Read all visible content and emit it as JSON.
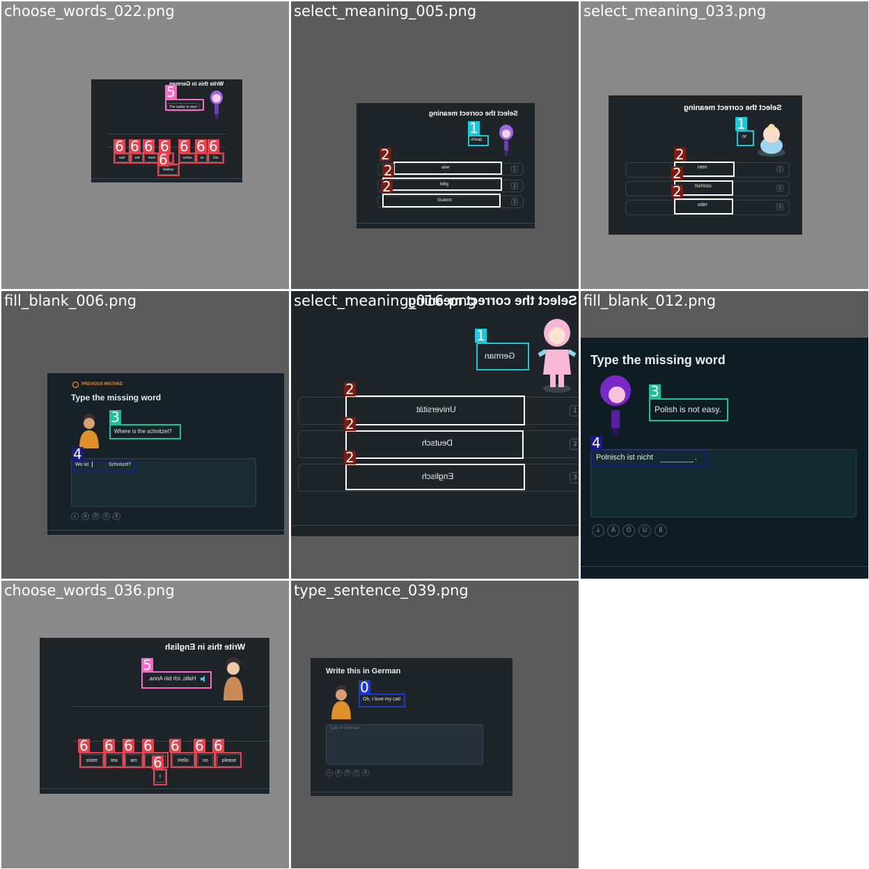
{
  "tiles": [
    {
      "name": "choose_words_022.png",
      "prompt_mirrored": "Write this in German",
      "bubble": "The waiter is nice!",
      "chips": [
        "nett",
        "Kellner",
        "mit",
        "mein",
        "ich",
        "schön",
        "ist",
        "Der"
      ],
      "tags": [
        "5",
        "6"
      ]
    },
    {
      "name": "select_meaning_005.png",
      "prompt_mirrored": "Select the correct meaning",
      "bubble": "cheap",
      "options": [
        "aber",
        "billig",
        "Student"
      ],
      "option_numbers": [
        "1",
        "2",
        "3"
      ],
      "tags": [
        "1",
        "2"
      ]
    },
    {
      "name": "select_meaning_033.png",
      "prompt_mirrored": "Select the correct meaning",
      "bubble": "or",
      "options": [
        "nein",
        "tschüss",
        "oder"
      ],
      "option_numbers": [
        "1",
        "2",
        "3"
      ],
      "tags": [
        "1",
        "2"
      ]
    },
    {
      "name": "fill_blank_006.png",
      "banner": "PREVIOUS MISTAKE",
      "prompt": "Type the missing word",
      "bubble": "Where is the schnitzel?",
      "sentence_before": "Wo ist",
      "sentence_after": "Schnitzel?",
      "keys": [
        "↓",
        "Ä",
        "Ö",
        "Ü",
        "ß"
      ],
      "tags": [
        "3",
        "4"
      ]
    },
    {
      "name": "select_meaning_016.png",
      "prompt_mirrored": "Select the correct meaning",
      "bubble": "German",
      "options": [
        "Universität",
        "Deutsch",
        "Englisch"
      ],
      "option_numbers": [
        "1",
        "2",
        "3"
      ],
      "tags": [
        "1",
        "2"
      ]
    },
    {
      "name": "fill_blank_012.png",
      "prompt": "Type the missing word",
      "bubble": "Polish is not easy.",
      "sentence_before": "Polnisch ist nicht",
      "sentence_after": ".",
      "keys": [
        "↓",
        "Ä",
        "Ö",
        "Ü",
        "ß"
      ],
      "tags": [
        "3",
        "4"
      ]
    },
    {
      "name": "choose_words_036.png",
      "prompt_mirrored": "Write this in English",
      "bubble": "Hallo, ich bin Anna.",
      "chips": [
        "sister",
        "I",
        "tea",
        "am",
        "a",
        "Hello",
        "no",
        "please"
      ],
      "tags": [
        "5",
        "6"
      ]
    },
    {
      "name": "type_sentence_039.png",
      "prompt": "Write this in German",
      "bubble": "Oh, I love my cat!",
      "placeholder": "Type in German",
      "keys": [
        "↓",
        "Ä",
        "Ö",
        "Ü",
        "ß"
      ],
      "tags": [
        "0"
      ]
    }
  ],
  "colors": {
    "app_bg": "#1f2428",
    "tile_bg_a": "#8a8a8a",
    "tile_bg_b": "#5b5b5b",
    "tag_pink": "#ff66cc",
    "tag_red": "#e8424e",
    "tag_cyan": "#1ec8d8",
    "tag_brown": "#7a1c12",
    "tag_teal": "#1fbf9a",
    "tag_navy": "#1a1a80",
    "tag_blue": "#1c39d8"
  }
}
